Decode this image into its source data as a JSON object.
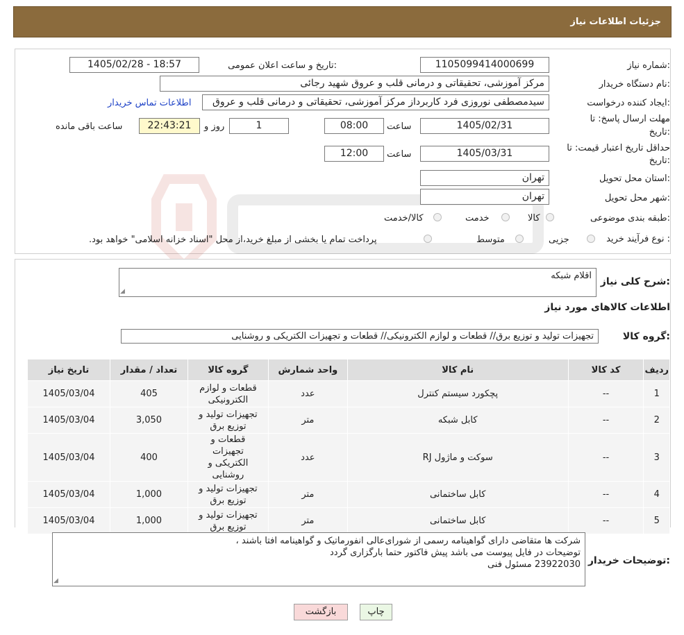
{
  "header": {
    "title": "جزئیات اطلاعات نیاز"
  },
  "form": {
    "need_number_label": "شماره نیاز:",
    "need_number": "1105099414000699",
    "announce_label": "تاریخ و ساعت اعلان عمومی:",
    "announce_value": "1405/02/28 - 18:57",
    "buyer_label": "نام دستگاه خریدار:",
    "buyer_value": "مرکز آموزشی، تحقیقاتی و درمانی قلب و عروق شهید رجائی",
    "creator_label": "ایجاد کننده درخواست:",
    "creator_value": "سیدمصطفی نوروزی فرد کاربرداز مرکز آموزشی، تحقیقاتی و درمانی قلب و عروق",
    "contact_link": "اطلاعات تماس خریدار",
    "deadline_label_1": "مهلت ارسال پاسخ: تا",
    "deadline_label_2": "تاریخ:",
    "deadline_date": "1405/02/31",
    "hour_label": "ساعت",
    "deadline_time": "08:00",
    "days_value": "1",
    "days_label": "روز و",
    "remaining_time": "22:43:21",
    "remaining_label": "ساعت باقی مانده",
    "validity_label_1": "حداقل تاریخ اعتبار قیمت: تا",
    "validity_label_2": "تاریخ:",
    "validity_date": "1405/03/31",
    "validity_time": "12:00",
    "province_label": "استان محل تحویل:",
    "province_value": "تهران",
    "city_label": "شهر محل تحویل:",
    "city_value": "تهران",
    "category_label": "طبقه بندی موضوعی:",
    "category_options": [
      "کالا",
      "خدمت",
      "کالا/خدمت"
    ],
    "process_label": "نوع فرآیند خرید :",
    "process_options": [
      "جزیی",
      "متوسط"
    ],
    "process_note": "پرداخت تمام یا بخشی از مبلغ خرید،از محل \"اسناد خزانه اسلامی\" خواهد بود."
  },
  "description": {
    "label": "شرح کلی نیاز:",
    "value": "اقلام شبکه"
  },
  "goods": {
    "section_title": "اطلاعات کالاهای مورد نیاز",
    "group_label": "گروه کالا:",
    "group_value": "تجهیزات تولید و توزیع برق// قطعات و لوازم الکترونیکی// قطعات و تجهیزات الکتریکی و روشنایی",
    "columns": [
      "ردیف",
      "کد کالا",
      "نام کالا",
      "واحد شمارش",
      "گروه کالا",
      "تعداد / مقدار",
      "تاریخ نیاز"
    ],
    "rows": [
      [
        "1",
        "--",
        "پچکورد سیستم کنترل",
        "عدد",
        "قطعات و لوازم الکترونیکی",
        "405",
        "1405/03/04"
      ],
      [
        "2",
        "--",
        "کابل شبکه",
        "متر",
        "تجهیزات تولید و توزیع برق",
        "3,050",
        "1405/03/04"
      ],
      [
        "3",
        "--",
        "سوکت و ماژول RJ",
        "عدد",
        "قطعات و تجهیزات الکتریکی و روشنایی",
        "400",
        "1405/03/04"
      ],
      [
        "4",
        "--",
        "کابل ساختمانی",
        "متر",
        "تجهیزات تولید و توزیع برق",
        "1,000",
        "1405/03/04"
      ],
      [
        "5",
        "--",
        "کابل ساختمانی",
        "متر",
        "تجهیزات تولید و توزیع برق",
        "1,000",
        "1405/03/04"
      ]
    ]
  },
  "buyer_notes": {
    "label": "توضیحات خریدار:",
    "lines": [
      "شرکت ها متقاضی دارای  گواهینامه رسمی از شورای‌عالی انفورماتیک و گواهینامه افتا باشند ،",
      "توضیحات در فایل پیوست می باشد پیش فاکتور حتما بارگزاری گردد",
      "23922030 مسئول فنی"
    ]
  },
  "buttons": {
    "print": "چاپ",
    "back": "بازگشت"
  },
  "colors": {
    "header_bg": "#8b6b3d",
    "link": "#1f43c7",
    "back_button": "#f9d9d9",
    "print_button": "#eaf7e4"
  }
}
